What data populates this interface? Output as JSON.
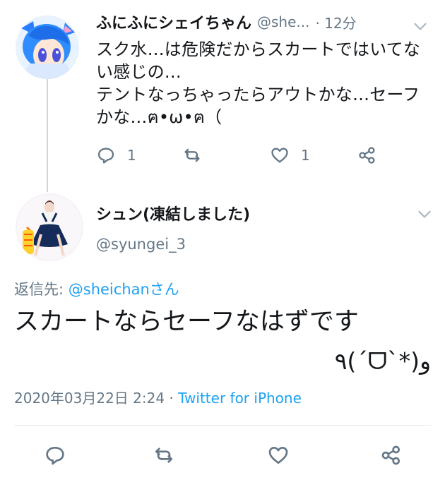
{
  "tweet_top": {
    "display_name": "ふにふにシェイちゃん",
    "handle": "@she...",
    "time": "· 12分",
    "text": "スク水…は危険だからスカートではいてない感じの…\nテントなっちゃったらアウトかな…セーフかな…ฅ•ω•ฅ（",
    "reply_count": "1",
    "like_count": "1",
    "icons": {
      "reply": "reply-icon",
      "retweet": "retweet-icon",
      "like": "heart-icon",
      "share": "share-icon",
      "more": "chevron-down-icon"
    }
  },
  "tweet_main": {
    "display_name": "シュン(凍結しました)",
    "handle": "@syungei_3",
    "reply_to_prefix": "返信先: ",
    "reply_to_handle": "@sheichanさん",
    "text_line1": "スカートならセーフなはずです",
    "text_line2": "٩(ˊᗜˋ*)و",
    "timestamp": "2020年03月22日 2:24 ·",
    "source": "Twitter for iPhone",
    "icons": {
      "reply": "reply-icon",
      "retweet": "retweet-icon",
      "like": "heart-icon",
      "share": "share-icon",
      "more": "chevron-down-icon"
    }
  },
  "colors": {
    "text": "#14171a",
    "secondary": "#657786",
    "link": "#1da1f2",
    "divider": "#e6ecf0"
  }
}
